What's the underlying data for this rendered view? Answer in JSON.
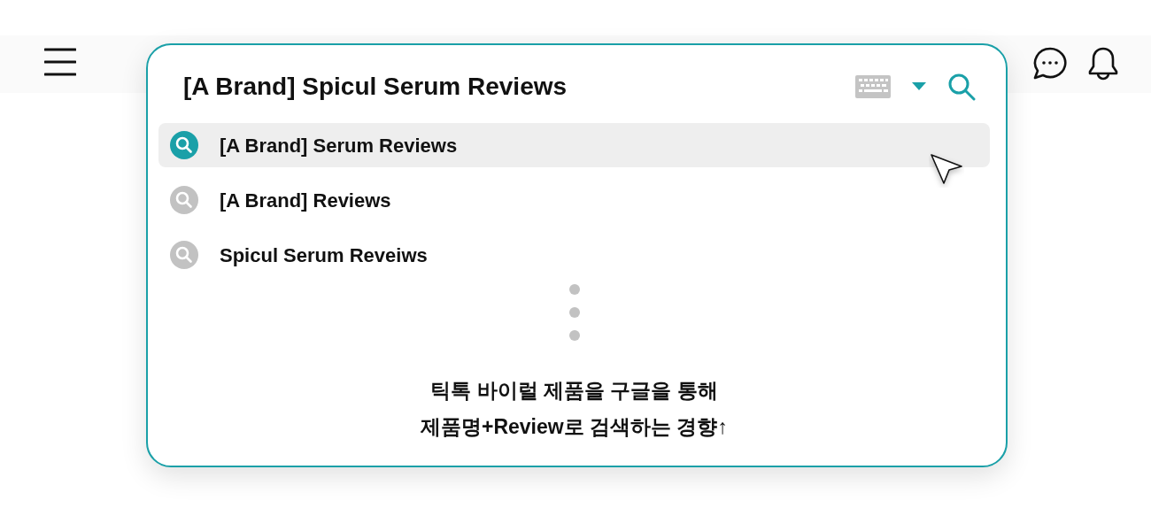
{
  "search": {
    "query": "[A Brand] Spicul Serum Reviews"
  },
  "suggestions": [
    {
      "text": "[A Brand] Serum Reviews",
      "selected": true
    },
    {
      "text": "[A Brand] Reviews",
      "selected": false
    },
    {
      "text": "Spicul Serum Reveiws",
      "selected": false
    }
  ],
  "caption_lines": [
    "틱톡 바이럴 제품을 구글을 통해",
    "제품명+Review로 검색하는 경향↑"
  ]
}
